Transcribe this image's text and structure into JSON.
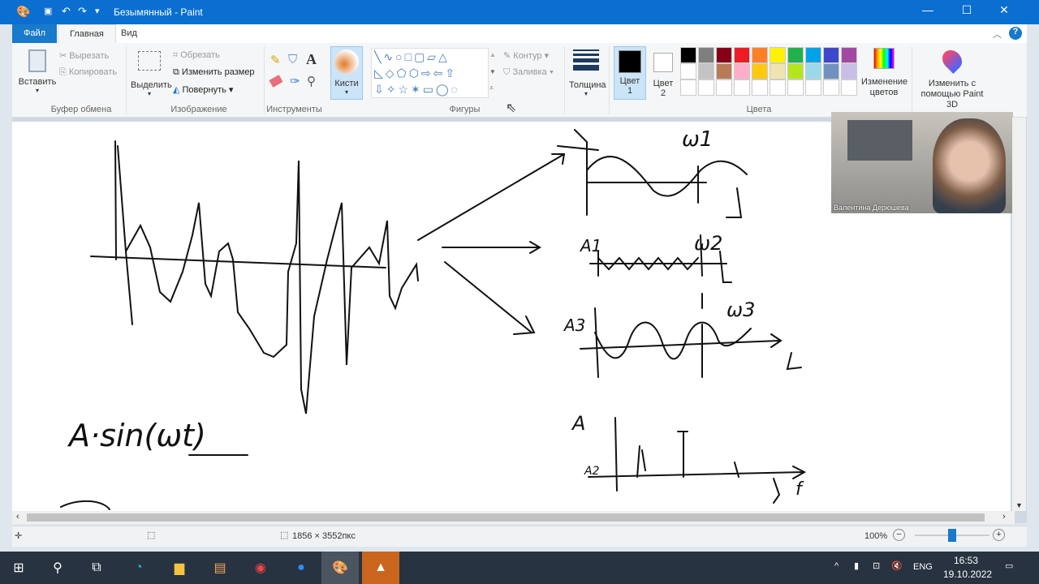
{
  "window": {
    "title": "Безымянный - Paint"
  },
  "tabs": [
    "Файл",
    "Главная",
    "Вид"
  ],
  "clipboard": {
    "paste": "Вставить",
    "cut": "Вырезать",
    "copy": "Копировать",
    "group": "Буфер обмена"
  },
  "image": {
    "select": "Выделить",
    "crop": "Обрезать",
    "resize": "Изменить размер",
    "rotate": "Повернуть",
    "group": "Изображение"
  },
  "tools": {
    "group": "Инструменты"
  },
  "brushes": {
    "label": "Кисти"
  },
  "shapes": {
    "outline": "Контур",
    "fill": "Заливка",
    "group": "Фигуры"
  },
  "size": {
    "label": "Толщина"
  },
  "colors": {
    "color1": "Цвет",
    "color1_num": "1",
    "color2": "Цвет",
    "color2_num": "2",
    "edit": "Изменение цветов",
    "paint3d": "Изменить с помощью Paint 3D",
    "group": "Цвета",
    "palette_row1": [
      "#000000",
      "#7f7f7f",
      "#880015",
      "#ed1c24",
      "#ff7f27",
      "#fff200",
      "#22b14c",
      "#00a2e8",
      "#3f48cc",
      "#a349a4"
    ],
    "palette_row2": [
      "#ffffff",
      "#c3c3c3",
      "#b97a57",
      "#ffaec9",
      "#ffc90e",
      "#efe4b0",
      "#b5e61d",
      "#99d9ea",
      "#7092be",
      "#c8bfe7"
    ]
  },
  "canvas": {
    "formula": "A·sin(ωt)",
    "w1": "ω1",
    "w2": "ω2",
    "w3": "ω3",
    "t": "t",
    "A1": "A1",
    "A2": "A2",
    "A3": "A3",
    "A": "A",
    "f": "f"
  },
  "webcam": {
    "name": "Валентина Дерюшева"
  },
  "status": {
    "size": "1856 × 3552пкс",
    "zoom": "100%",
    "zoom_fraction": 0.5
  },
  "taskbar": {
    "lang": "ENG",
    "time": "16:53",
    "date": "19.10.2022"
  }
}
